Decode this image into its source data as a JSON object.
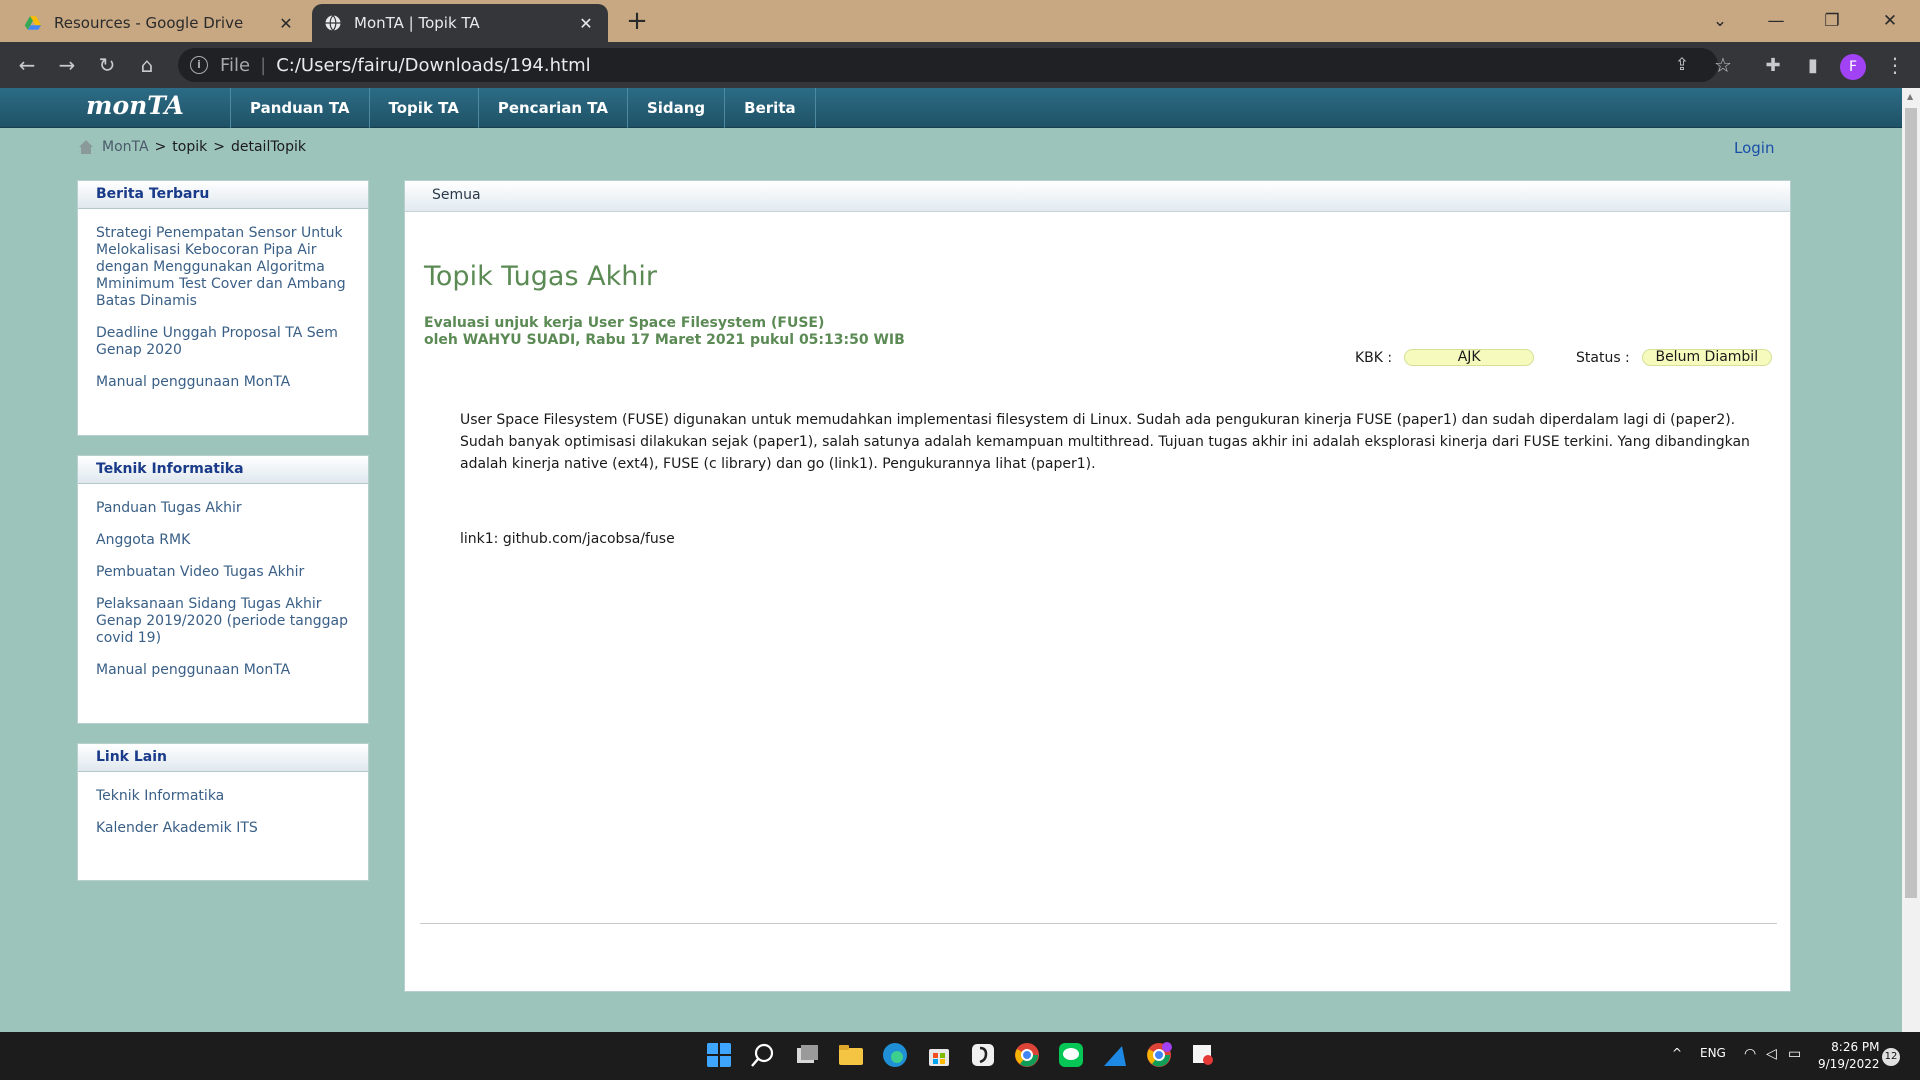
{
  "browser": {
    "tabs": [
      {
        "title": "Resources - Google Drive",
        "icon": "google-drive-icon"
      },
      {
        "title": "MonTA | Topik TA",
        "icon": "globe-icon"
      }
    ],
    "address_prefix": "File",
    "url": "C:/Users/fairu/Downloads/194.html",
    "profile_initial": "F"
  },
  "site": {
    "logo": "monTA",
    "nav": [
      "Panduan TA",
      "Topik TA",
      "Pencarian TA",
      "Sidang",
      "Berita"
    ],
    "breadcrumb": [
      "MonTA",
      "topik",
      "detailTopik"
    ],
    "login": "Login"
  },
  "sidebar": [
    {
      "title": "Berita Terbaru",
      "links": [
        "Strategi Penempatan Sensor Untuk Melokalisasi Kebocoran Pipa Air dengan Menggunakan Algoritma Mminimum Test Cover dan Ambang Batas Dinamis",
        "Deadline Unggah Proposal TA Sem Genap 2020",
        "Manual penggunaan MonTA"
      ]
    },
    {
      "title": "Teknik Informatika",
      "links": [
        "Panduan Tugas Akhir",
        "Anggota RMK",
        "Pembuatan Video Tugas Akhir",
        "Pelaksanaan Sidang Tugas Akhir Genap 2019/2020 (periode tanggap covid 19)",
        "Manual penggunaan MonTA"
      ]
    },
    {
      "title": "Link Lain",
      "links": [
        "Teknik Informatika",
        "Kalender Akademik ITS"
      ]
    }
  ],
  "main": {
    "tab": "Semua",
    "title": "Topik Tugas Akhir",
    "topic": "Evaluasi unjuk kerja User Space Filesystem (FUSE)",
    "byline": "oleh WAHYU SUADI, Rabu 17 Maret 2021 pukul 05:13:50 WIB",
    "kbk_label": "KBK :",
    "kbk_value": "AJK",
    "status_label": "Status :",
    "status_value": "Belum Diambil",
    "description": "User Space Filesystem (FUSE) digunakan untuk memudahkan implementasi filesystem di Linux. Sudah ada pengukuran kinerja FUSE (paper1) dan sudah diperdalam lagi di (paper2). Sudah banyak optimisasi dilakukan sejak (paper1), salah satunya adalah kemampuan multithread. Tujuan tugas akhir ini adalah eksplorasi kinerja dari FUSE terkini. Yang dibandingkan adalah kinerja native (ext4), FUSE (c library) dan go (link1). Pengukurannya lihat (paper1).",
    "link_line": "link1: github.com/jacobsa/fuse"
  },
  "taskbar": {
    "lang": "ENG",
    "time": "8:26 PM",
    "date": "9/19/2022",
    "notifications": "12"
  }
}
